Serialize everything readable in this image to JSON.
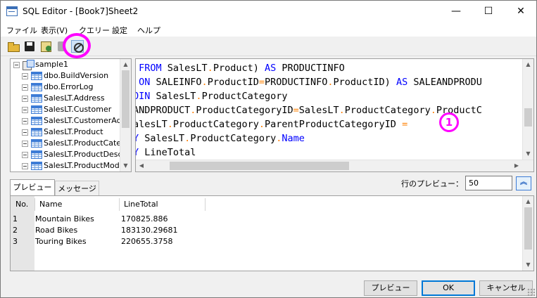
{
  "window": {
    "title": "SQL Editor - [Book7]Sheet2",
    "controls": {
      "minimize": "—",
      "maximize": "☐",
      "close": "✕"
    }
  },
  "menu": [
    "ファイル",
    "表示(V)",
    "クエリー",
    "設定",
    "ヘルプ"
  ],
  "toolbar": [
    "open-icon",
    "save-icon",
    "execute-icon",
    "stop-icon",
    "clear-icon"
  ],
  "tree": {
    "root": "sample1",
    "items": [
      "dbo.BuildVersion",
      "dbo.ErrorLog",
      "SalesLT.Address",
      "SalesLT.Customer",
      "SalesLT.CustomerAdd",
      "SalesLT.Product",
      "SalesLT.ProductCateg",
      "SalesLT.ProductDescr",
      "SalesLT.ProductMode"
    ]
  },
  "editor": {
    "lines": [
      [
        {
          "t": "kw",
          "v": " FROM"
        },
        {
          "t": "tx",
          "v": " SalesLT"
        },
        {
          "t": "op",
          "v": "."
        },
        {
          "t": "tx",
          "v": "Product) "
        },
        {
          "t": "kw",
          "v": "AS"
        },
        {
          "t": "tx",
          "v": " PRODUCTINFO"
        }
      ],
      [
        {
          "t": "kw",
          "v": " ON"
        },
        {
          "t": "tx",
          "v": " SALEINFO"
        },
        {
          "t": "op",
          "v": "."
        },
        {
          "t": "tx",
          "v": "ProductID"
        },
        {
          "t": "op",
          "v": "="
        },
        {
          "t": "tx",
          "v": "PRODUCTINFO"
        },
        {
          "t": "op",
          "v": "."
        },
        {
          "t": "tx",
          "v": "ProductID) "
        },
        {
          "t": "kw",
          "v": "AS"
        },
        {
          "t": "tx",
          "v": " SALEANDPRODU"
        }
      ],
      [
        {
          "t": "kw",
          "v": "OIN"
        },
        {
          "t": "tx",
          "v": " SalesLT"
        },
        {
          "t": "op",
          "v": "."
        },
        {
          "t": "tx",
          "v": "ProductCategory"
        }
      ],
      [
        {
          "t": "tx",
          "v": "ANDPRODUCT"
        },
        {
          "t": "op",
          "v": "."
        },
        {
          "t": "tx",
          "v": "ProductCategoryID"
        },
        {
          "t": "op",
          "v": "="
        },
        {
          "t": "tx",
          "v": "SalesLT"
        },
        {
          "t": "op",
          "v": "."
        },
        {
          "t": "tx",
          "v": "ProductCategory"
        },
        {
          "t": "op",
          "v": "."
        },
        {
          "t": "tx",
          "v": "ProductC"
        }
      ],
      [
        {
          "t": "tx",
          "v": "alesLT"
        },
        {
          "t": "op",
          "v": "."
        },
        {
          "t": "tx",
          "v": "ProductCategory"
        },
        {
          "t": "op",
          "v": "."
        },
        {
          "t": "tx",
          "v": "ParentProductCategoryID "
        },
        {
          "t": "op",
          "v": "="
        }
      ],
      [
        {
          "t": "kw",
          "v": "Y"
        },
        {
          "t": "tx",
          "v": " SalesLT"
        },
        {
          "t": "op",
          "v": "."
        },
        {
          "t": "tx",
          "v": "ProductCategory"
        },
        {
          "t": "op",
          "v": "."
        },
        {
          "t": "kw",
          "v": "Name"
        }
      ],
      [
        {
          "t": "kw",
          "v": "Y"
        },
        {
          "t": "tx",
          "v": " LineTotal"
        }
      ]
    ],
    "badge": "1"
  },
  "tabs": [
    "プレビュー",
    "メッセージ"
  ],
  "row_preview": {
    "label": "行のプレビュー：",
    "value": "50",
    "collapse": "︽"
  },
  "results": {
    "columns": [
      "No.",
      "Name",
      "LineTotal"
    ],
    "rows": [
      [
        "1",
        "Mountain Bikes",
        "170825.886"
      ],
      [
        "2",
        "Road Bikes",
        "183130.29681"
      ],
      [
        "3",
        "Touring Bikes",
        "220655.3758"
      ]
    ]
  },
  "buttons": {
    "preview": "プレビュー",
    "ok": "OK",
    "cancel": "キャンセル"
  },
  "colors": {
    "keyword": "#0000ff",
    "operator": "#ff8000",
    "callout": "#ff00ff"
  }
}
